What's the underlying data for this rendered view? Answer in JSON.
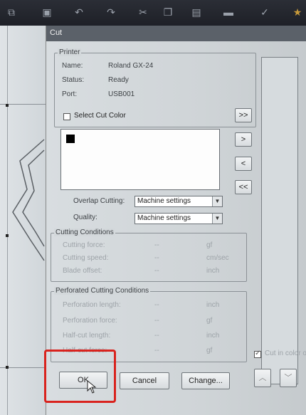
{
  "dialog": {
    "title": "Cut"
  },
  "printer": {
    "group_title": "Printer",
    "name_label": "Name:",
    "name_value": "Roland GX-24",
    "status_label": "Status:",
    "status_value": "Ready",
    "port_label": "Port:",
    "port_value": "USB001"
  },
  "select_cut_color": {
    "label": "Select Cut Color",
    "checked": false
  },
  "swatch_color": "#000000",
  "move_buttons": [
    ">>",
    ">",
    "<",
    "<<"
  ],
  "overlap_cutting": {
    "label": "Overlap Cutting:",
    "value": "Machine settings"
  },
  "quality": {
    "label": "Quality:",
    "value": "Machine settings"
  },
  "cutting_conditions": {
    "group_title": "Cutting Conditions",
    "rows": [
      {
        "label": "Cutting force:",
        "value": "--",
        "unit": "gf"
      },
      {
        "label": "Cutting speed:",
        "value": "--",
        "unit": "cm/sec"
      },
      {
        "label": "Blade offset:",
        "value": "--",
        "unit": "inch"
      }
    ]
  },
  "perforated_conditions": {
    "group_title": "Perforated Cutting Conditions",
    "rows": [
      {
        "label": "Perforation length:",
        "value": "--",
        "unit": "inch"
      },
      {
        "label": "Perforation force:",
        "value": "--",
        "unit": "gf"
      },
      {
        "label": "Half-cut length:",
        "value": "--",
        "unit": "inch"
      },
      {
        "label": "Half-cut force:",
        "value": "--",
        "unit": "gf"
      }
    ]
  },
  "buttons": {
    "ok": "OK",
    "cancel": "Cancel",
    "change": "Change..."
  },
  "cut_in_color_order": {
    "label": "Cut in color o",
    "checked": true
  },
  "colors": {
    "highlight": "#d9231e"
  }
}
